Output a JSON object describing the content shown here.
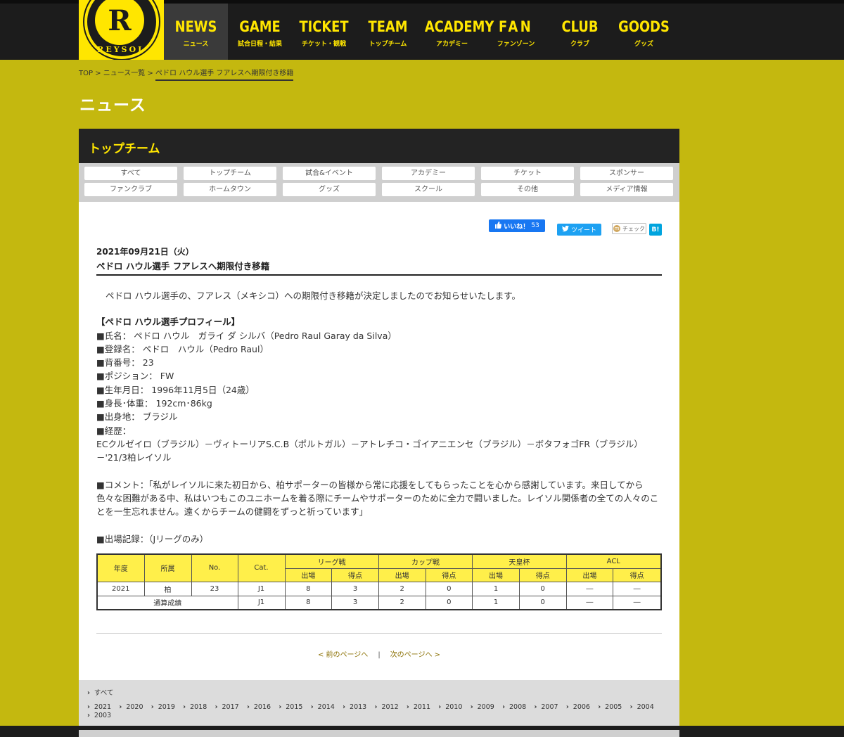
{
  "logo": {
    "letter": "R",
    "text": "REYSOL"
  },
  "nav": [
    {
      "en": "NEWS",
      "jp": "ニュース",
      "active": true
    },
    {
      "en": "GAME",
      "jp": "試合日程・結果"
    },
    {
      "en": "TICKET",
      "jp": "チケット・観戦"
    },
    {
      "en": "TEAM",
      "jp": "トップチーム"
    },
    {
      "en": "ACADEMY",
      "jp": "アカデミー"
    },
    {
      "en": "FAN",
      "jp": "ファンゾーン"
    },
    {
      "en": "CLUB",
      "jp": "クラブ"
    },
    {
      "en": "GOODS",
      "jp": "グッズ"
    }
  ],
  "breadcrumb": {
    "top": "TOP",
    "sep": " > ",
    "list": "ニュース一覧",
    "current": "ペドロ ハウル選手 フアレスへ期限付き移籍"
  },
  "page_title": "ニュース",
  "panel_title": "トップチーム",
  "categories": [
    "すべて",
    "トップチーム",
    "試合&イベント",
    "アカデミー",
    "チケット",
    "スポンサー",
    "ファンクラブ",
    "ホームタウン",
    "グッズ",
    "スクール",
    "その他",
    "メディア情報"
  ],
  "social": {
    "fb_like": "いいね！",
    "fb_count": "53",
    "tweet": "ツイート",
    "check": "チェック",
    "hatena": "B!"
  },
  "article": {
    "date": "2021年09月21日（火）",
    "title": "ペドロ ハウル選手 フアレスへ期限付き移籍",
    "intro": "ペドロ ハウル選手の、フアレス（メキシコ）への期限付き移籍が決定しましたのでお知らせいたします。",
    "profile_heading": "【ペドロ ハウル選手プロフィール】",
    "profile": [
      "■氏名： ペドロ ハウル　ガライ ダ シルバ（Pedro Raul Garay da Silva）",
      "■登録名： ペドロ　ハウル（Pedro Raul）",
      "■背番号： 23",
      "■ポジション： FW",
      "■生年月日： 1996年11月5日（24歳）",
      "■身長･体重： 192cm･86kg",
      "■出身地： ブラジル",
      "■経歴："
    ],
    "career": "ECクルゼイロ（ブラジル）－ヴィトーリアS.C.B（ポルトガル）－アトレチコ・ゴイアニエンセ（ブラジル）－ボタフォゴFR（ブラジル）－'21/3柏レイソル",
    "comment": "■コメント：「私がレイソルに来た初日から、柏サポーターの皆様から常に応援をしてもらったことを心から感謝しています。来日してから色々な困難がある中、私はいつもこのユニホームを着る際にチームやサポーターのために全力で闘いました。レイソル関係者の全ての人々のことを一生忘れません。遠くからチームの健闘をずっと祈っています」",
    "record_label": "■出場記録：（Jリーグのみ）"
  },
  "stats": {
    "headers": {
      "year": "年度",
      "club": "所属",
      "no": "No.",
      "cat": "Cat.",
      "league": "リーグ戦",
      "cup": "カップ戦",
      "emperor": "天皇杯",
      "acl": "ACL",
      "apps": "出場",
      "goals": "得点"
    },
    "rows": [
      {
        "year": "2021",
        "club": "柏",
        "no": "23",
        "cat": "J1",
        "v": [
          "8",
          "3",
          "2",
          "0",
          "1",
          "0",
          "―",
          "―"
        ]
      }
    ],
    "total": {
      "label": "通算成績",
      "cat": "J1",
      "v": [
        "8",
        "3",
        "2",
        "0",
        "1",
        "0",
        "―",
        "―"
      ]
    }
  },
  "pager": {
    "prev": "< 前のページへ",
    "sep": "|",
    "next": "次のページへ >"
  },
  "archive": {
    "all": "すべて",
    "years": [
      "2021",
      "2020",
      "2019",
      "2018",
      "2017",
      "2016",
      "2015",
      "2014",
      "2013",
      "2012",
      "2011",
      "2010",
      "2009",
      "2008",
      "2007",
      "2006",
      "2005",
      "2004",
      "2003"
    ]
  }
}
